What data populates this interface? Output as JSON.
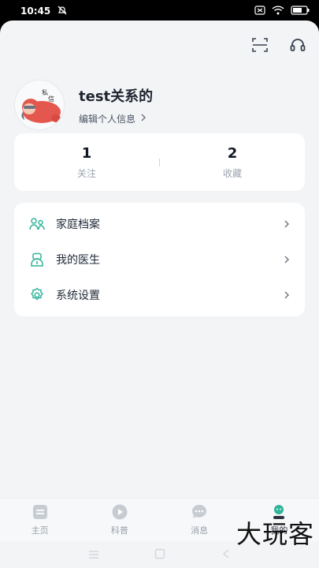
{
  "status_bar": {
    "time": "10:45",
    "icons": [
      "notifications-off-icon",
      "sim-icon",
      "wifi-icon",
      "battery-icon"
    ]
  },
  "header": {
    "actions": [
      "scan-icon",
      "headset-icon"
    ]
  },
  "profile": {
    "name": "test关系的",
    "edit_label": "编辑个人信息"
  },
  "stats": [
    {
      "value": "1",
      "label": "关注"
    },
    {
      "value": "2",
      "label": "收藏"
    }
  ],
  "menu": [
    {
      "label": "家庭档案",
      "icon": "family-icon"
    },
    {
      "label": "我的医生",
      "icon": "doctor-icon"
    },
    {
      "label": "系统设置",
      "icon": "settings-icon"
    }
  ],
  "tabs": [
    {
      "label": "主页",
      "icon": "home-icon",
      "active": false
    },
    {
      "label": "科普",
      "icon": "play-icon",
      "active": false
    },
    {
      "label": "消息",
      "icon": "message-icon",
      "active": false
    },
    {
      "label": "我的",
      "icon": "profile-icon",
      "active": true
    }
  ],
  "colors": {
    "accent": "#2fb39a",
    "background": "#f3f4f6",
    "card": "#ffffff"
  },
  "watermark": "大玩客"
}
